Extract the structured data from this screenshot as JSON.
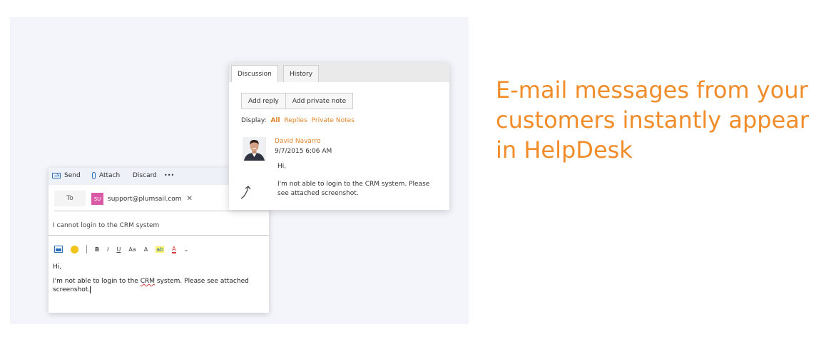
{
  "headline": [
    "E-mail messages from your",
    "customers instantly appear",
    "in HelpDesk"
  ],
  "compose": {
    "toolbar": {
      "send": "Send",
      "attach": "Attach",
      "discard": "Discard",
      "more": "•••"
    },
    "to_label": "To",
    "recipient_initials": "SU",
    "recipient_email": "support@plumsail.com",
    "remove_glyph": "✕",
    "subject": "I cannot login to the CRM system",
    "format": {
      "bold": "B",
      "italic": "I",
      "underline": "U",
      "font_size": "Aa",
      "superscript": "A",
      "highlight": "ab",
      "font_color": "A",
      "more": "⌄"
    },
    "body_greeting": "Hi,",
    "body_text_before": "I'm not able to login to the ",
    "body_crm": "CRM",
    "body_text_after": " system. Please see attached screenshot."
  },
  "discussion": {
    "tabs": [
      "Discussion",
      "History"
    ],
    "buttons": {
      "add_reply": "Add reply",
      "add_private_note": "Add private note"
    },
    "display_label": "Display:",
    "filters": [
      "All",
      "Replies",
      "Private Notes"
    ],
    "message": {
      "author": "David Navarro",
      "date": "9/7/2015 6:06 AM",
      "greeting": "Hi,",
      "text": "I'm not able to login to the CRM system. Please see attached screenshot."
    }
  },
  "colors": {
    "accent": "#f08c2a",
    "link": "#e0842b",
    "brand_blue": "#2a6ebb",
    "badge": "#d95aa6"
  }
}
